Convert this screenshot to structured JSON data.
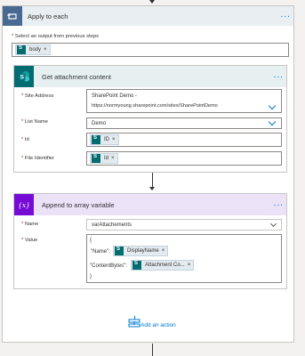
{
  "apply_each": {
    "title": "Apply to each",
    "more": "···",
    "select_label": "Select an output from previous steps",
    "token": "body",
    "token_x": "×"
  },
  "get_attachment": {
    "title": "Get attachment content",
    "more": "···",
    "site_label": "Site Address",
    "site_value_line1": "SharePoint Demo -",
    "site_value_line2": "https://normyoung.sharepoint.com/sites/SharePointDemo",
    "list_label": "List Name",
    "list_value": "Demo",
    "id_label": "Id",
    "id_token": "ID",
    "file_label": "File Identifier",
    "file_token": "Id",
    "token_x": "×"
  },
  "append": {
    "title": "Append to array variable",
    "more": "···",
    "icon_text": "{x}",
    "name_label": "Name",
    "name_value": "varAttachements",
    "value_label": "Value",
    "brace_open": "{",
    "name_key": "\"Name\":",
    "name_token": "DisplayName",
    "bytes_key": "\"ContentBytes\":",
    "bytes_token": "Attachment Co...",
    "brace_close": "}",
    "token_x": "×"
  },
  "add_action": {
    "label": "Add an action"
  },
  "required_mark": "*",
  "colors": {
    "apply_header": "#e8eef2",
    "apply_icon": "#486991",
    "sp_header": "#e6f0f1",
    "sp_icon": "#036c70",
    "var_header": "#ece2f8",
    "var_icon": "#770bd6",
    "link": "#0078d4"
  }
}
